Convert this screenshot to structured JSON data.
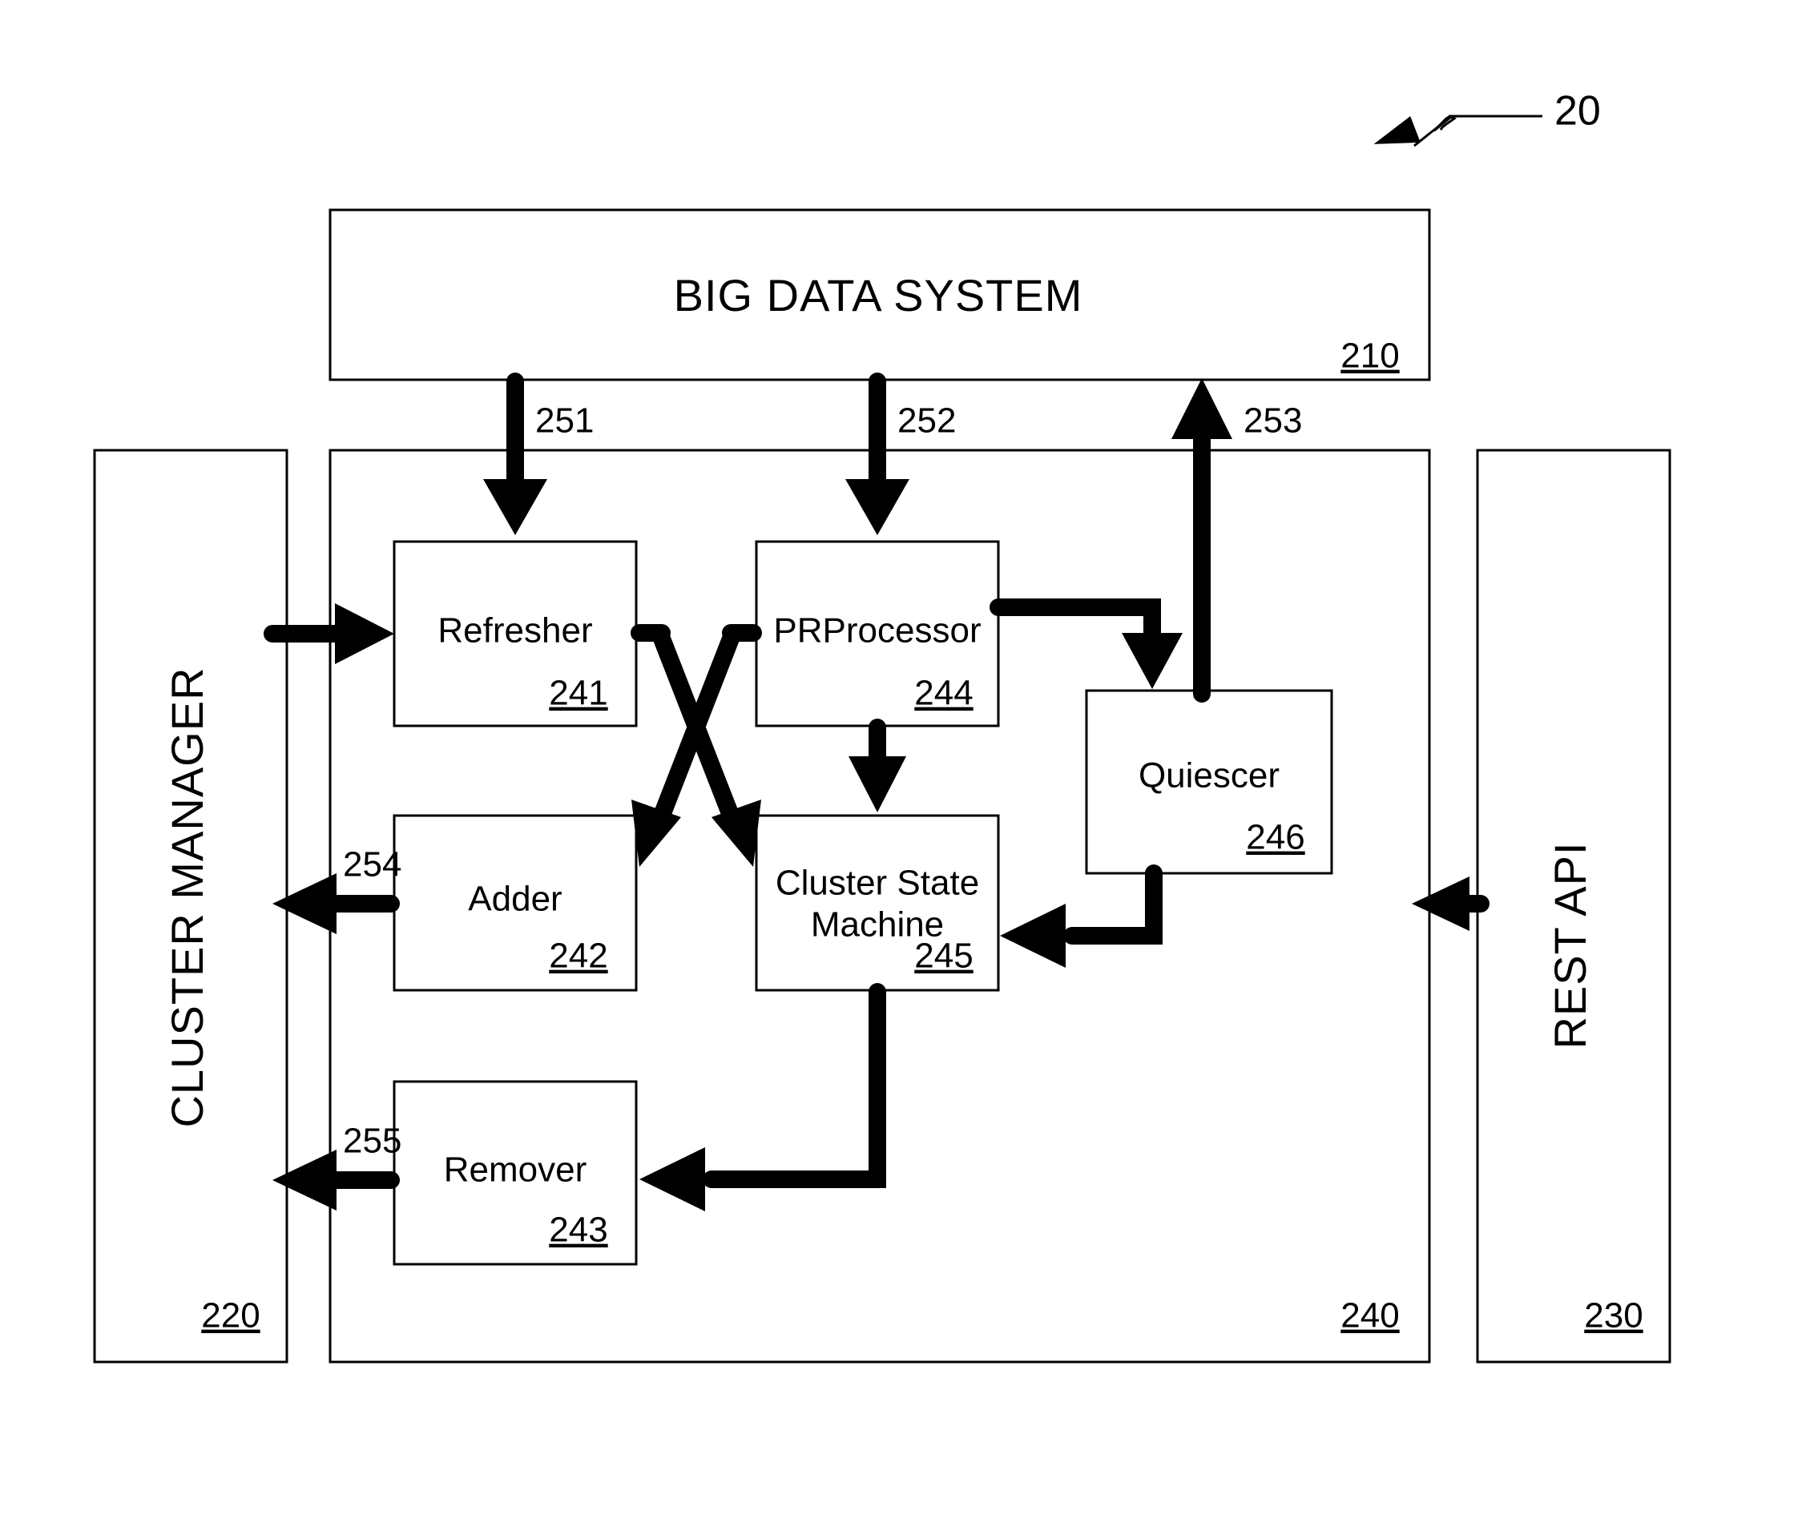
{
  "figure": {
    "label": "20"
  },
  "blocks": {
    "big_data_system": {
      "title": "BIG DATA SYSTEM",
      "ref": "210"
    },
    "cluster_manager": {
      "title": "CLUSTER MANAGER",
      "ref": "220"
    },
    "rest_api": {
      "title": "REST API",
      "ref": "230"
    },
    "container": {
      "ref": "240"
    },
    "refresher": {
      "title": "Refresher",
      "ref": "241"
    },
    "adder": {
      "title": "Adder",
      "ref": "242"
    },
    "remover": {
      "title": "Remover",
      "ref": "243"
    },
    "prprocessor": {
      "title": "PRProcessor",
      "ref": "244"
    },
    "cluster_state_machine": {
      "title_line1": "Cluster State",
      "title_line2": "Machine",
      "ref": "245"
    },
    "quiescer": {
      "title": "Quiescer",
      "ref": "246"
    }
  },
  "flow_labels": {
    "l251": "251",
    "l252": "252",
    "l253": "253",
    "l254": "254",
    "l255": "255"
  },
  "chart_data": {
    "type": "diagram",
    "title": "Big Data System block diagram",
    "nodes": [
      {
        "id": "210",
        "label": "BIG DATA SYSTEM",
        "ref": "210"
      },
      {
        "id": "220",
        "label": "CLUSTER MANAGER",
        "ref": "220"
      },
      {
        "id": "230",
        "label": "REST API",
        "ref": "230"
      },
      {
        "id": "240",
        "label": "",
        "ref": "240"
      },
      {
        "id": "241",
        "label": "Refresher",
        "ref": "241"
      },
      {
        "id": "242",
        "label": "Adder",
        "ref": "242"
      },
      {
        "id": "243",
        "label": "Remover",
        "ref": "243"
      },
      {
        "id": "244",
        "label": "PRProcessor",
        "ref": "244"
      },
      {
        "id": "245",
        "label": "Cluster State Machine",
        "ref": "245"
      },
      {
        "id": "246",
        "label": "Quiescer",
        "ref": "246"
      }
    ],
    "edges": [
      {
        "from": "210",
        "to": "241",
        "label": "251"
      },
      {
        "from": "210",
        "to": "244",
        "label": "252"
      },
      {
        "from": "246",
        "to": "210",
        "label": "253"
      },
      {
        "from": "242",
        "to": "220",
        "label": "254"
      },
      {
        "from": "243",
        "to": "220",
        "label": "255"
      },
      {
        "from": "220",
        "to": "241",
        "label": ""
      },
      {
        "from": "241",
        "to": "245",
        "label": ""
      },
      {
        "from": "244",
        "to": "242",
        "label": ""
      },
      {
        "from": "244",
        "to": "245",
        "label": ""
      },
      {
        "from": "244",
        "to": "246",
        "label": ""
      },
      {
        "from": "246",
        "to": "245",
        "label": ""
      },
      {
        "from": "245",
        "to": "243",
        "label": ""
      },
      {
        "from": "230",
        "to": "240",
        "label": ""
      }
    ]
  }
}
